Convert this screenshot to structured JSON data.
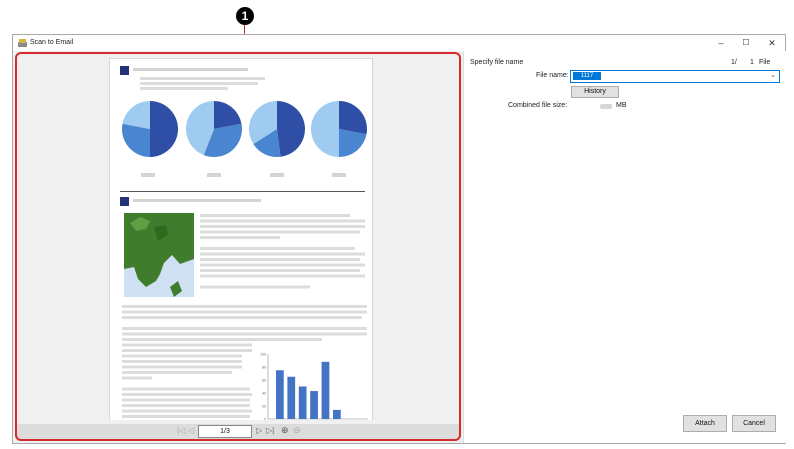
{
  "callout": {
    "number": "1"
  },
  "window": {
    "title": "Scan to Email",
    "minimize": "–",
    "maximize": "☐",
    "close": "✕"
  },
  "preview": {
    "page_input": "1/3",
    "nav": {
      "first": "|◁",
      "prev": "◁",
      "next": "▷",
      "last": "▷|",
      "zoom_in": "⊕",
      "zoom_out": "⊖"
    },
    "chart": {
      "y_ticks": [
        "100",
        "80",
        "60",
        "40",
        "20",
        "0"
      ],
      "values": [
        75,
        65,
        50,
        43,
        88,
        14
      ],
      "ylim": [
        0,
        100
      ],
      "color": "#4472c4"
    },
    "pies": [
      {
        "slices": [
          0.5,
          0.28,
          0.22
        ]
      },
      {
        "slices": [
          0.22,
          0.34,
          0.44
        ]
      },
      {
        "slices": [
          0.48,
          0.18,
          0.34
        ]
      },
      {
        "slices": [
          0.28,
          0.22,
          0.5
        ]
      }
    ],
    "pie_colors": [
      "#2f4fa6",
      "#4a86d0",
      "#9ecbef"
    ],
    "heading_color": "#22337a"
  },
  "right": {
    "specify_label": "Specify file name",
    "count_index": "1/",
    "count_total": "1",
    "count_unit": "File",
    "file_name_label": "File name:",
    "file_name_value": "1117",
    "history_button": "History",
    "combined_size_label": "Combined file size:",
    "size_unit": "MB",
    "attach_button": "Attach",
    "cancel_button": "Cancel"
  }
}
